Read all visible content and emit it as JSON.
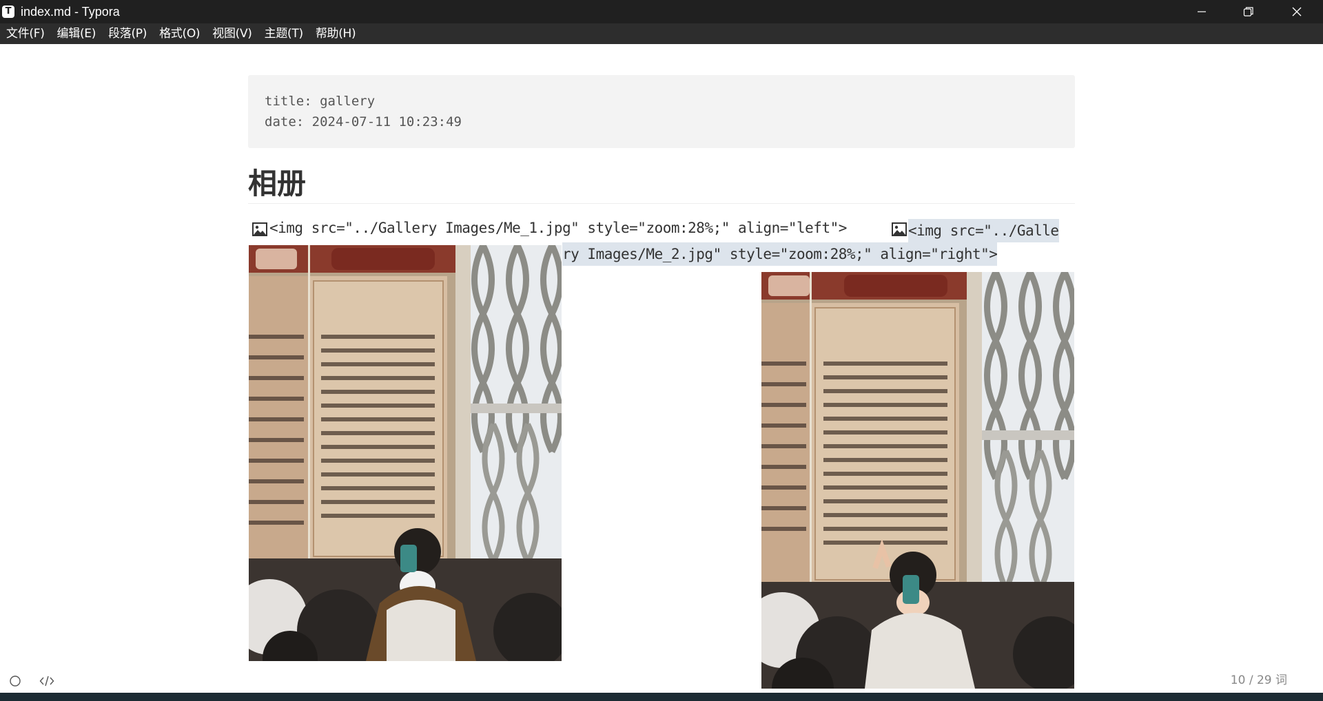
{
  "window": {
    "app_icon_letter": "T",
    "title": "index.md - Typora",
    "controls": {
      "minimize": "minimize-icon",
      "restore": "restore-icon",
      "close": "close-icon"
    }
  },
  "menu": {
    "items": [
      "文件(F)",
      "编辑(E)",
      "段落(P)",
      "格式(O)",
      "视图(V)",
      "主题(T)",
      "帮助(H)"
    ]
  },
  "document": {
    "front_matter": {
      "line1": "title: gallery",
      "line2": "date: 2024-07-11 10:23:49"
    },
    "heading": "相册",
    "img1_code": "<img src=\"../Gallery Images/Me_1.jpg\" style=\"zoom:28%;\" align=\"left\">",
    "img2_code_part1": "<img src=\"../Galle",
    "img2_code_part2": "ry Images/Me_2.jpg\" style=\"zoom:28%;\" align=\"right\">"
  },
  "status": {
    "word_count": "10 / 29 词",
    "left_icons": [
      "outline-toggle-icon",
      "source-code-mode-icon"
    ]
  },
  "colors": {
    "titlebar_bg": "#202020",
    "menubar_bg": "#2d2d2d",
    "code_highlight": "#dde4ec",
    "front_matter_bg": "#f3f3f3"
  }
}
